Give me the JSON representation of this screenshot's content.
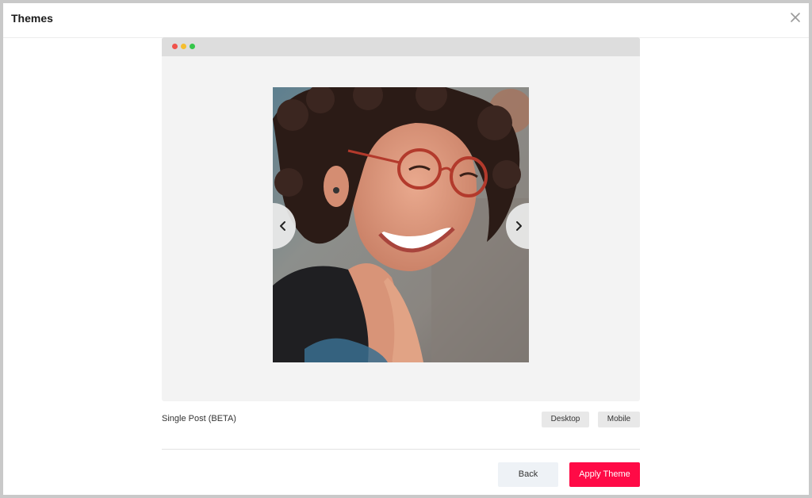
{
  "modal": {
    "title": "Themes",
    "close_icon": "close-icon"
  },
  "preview": {
    "window_dots": [
      {
        "name": "red-dot",
        "color": "#f0524b"
      },
      {
        "name": "yellow-dot",
        "color": "#f6be2f"
      },
      {
        "name": "green-dot",
        "color": "#35c64a"
      }
    ],
    "image": {
      "subject": "photo-of-smiling-woman-with-curly-hair-and-glasses"
    },
    "prev_icon": "chevron-left-icon",
    "next_icon": "chevron-right-icon"
  },
  "theme": {
    "name": "Single Post (BETA)"
  },
  "devices": {
    "desktop_label": "Desktop",
    "mobile_label": "Mobile"
  },
  "footer": {
    "back_label": "Back",
    "apply_label": "Apply Theme"
  },
  "colors": {
    "accent": "#ff0a46"
  }
}
